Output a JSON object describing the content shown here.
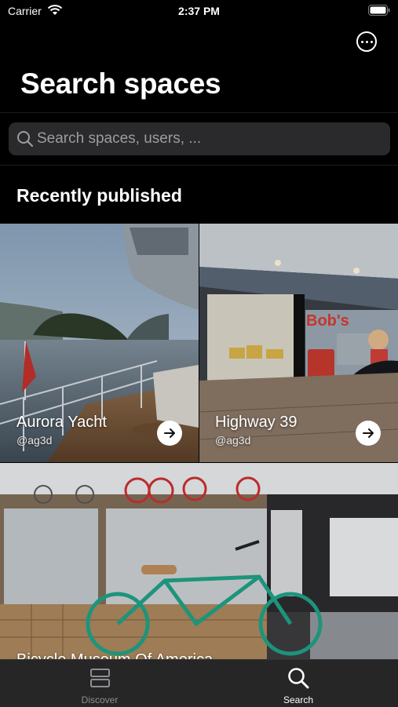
{
  "status_bar": {
    "carrier": "Carrier",
    "time": "2:37 PM"
  },
  "header": {
    "title": "Search spaces"
  },
  "search": {
    "placeholder": "Search spaces, users, ..."
  },
  "section": {
    "title": "Recently published"
  },
  "cards": [
    {
      "name": "Aurora Yacht",
      "user": "@ag3d"
    },
    {
      "name": "Highway 39",
      "user": "@ag3d"
    },
    {
      "name": "Bicycle Museum Of America"
    }
  ],
  "tabbar": {
    "tabs": [
      {
        "label": "Discover",
        "icon": "discover-icon",
        "active": false
      },
      {
        "label": "Search",
        "icon": "search-icon",
        "active": true
      }
    ]
  },
  "colors": {
    "background": "#000000",
    "search_field": "#2a2a2d",
    "tab_inactive": "#8e8e93",
    "tab_active": "#ffffff"
  }
}
